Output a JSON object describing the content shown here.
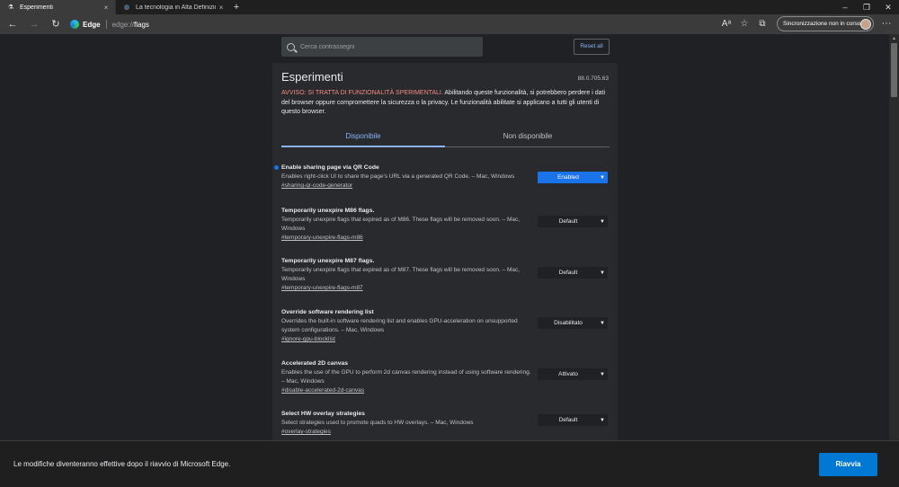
{
  "browser": {
    "tabs": [
      {
        "title": "Esperimenti",
        "close": "×",
        "icon": "flask-icon"
      },
      {
        "title": "La tecnologia in Alta Definizione",
        "close": "×",
        "icon": "globe-icon"
      }
    ],
    "new_tab": "+",
    "window_controls": {
      "minimize": "–",
      "maximize": "❐",
      "close": "✕"
    },
    "toolbar": {
      "back": "←",
      "forward": "→",
      "refresh": "↻",
      "edge_label": "Edge",
      "url_prefix": "edge://",
      "url_path": "flags",
      "sync_label": "Sincronizzazione non in corso",
      "menu": "···"
    }
  },
  "page": {
    "search_placeholder": "Cerca contrassegni",
    "reset_all": "Reset all",
    "title": "Esperimenti",
    "version": "88.0.705.63",
    "warning_label": "AVVISO: SI TRATTA DI FUNZIONALITÀ SPERIMENTALI.",
    "warning_text": " Abilitando queste funzionalità, si potrebbero perdere i dati del browser oppure compromettere la sicurezza o la privacy. Le funzionalità abilitate si applicano a tutti gli utenti di questo browser.",
    "tab_available": "Disponibile",
    "tab_unavailable": "Non disponibile",
    "flags": [
      {
        "name": "Enable sharing page via QR Code",
        "desc": "Enables right-click UI to share the page's URL via a generated QR Code. – Mac, Windows",
        "link": "#sharing-qr-code-generator",
        "value": "Enabled"
      },
      {
        "name": "Temporarily unexpire M86 flags.",
        "desc": "Temporarily unexpire flags that expired as of M86. These flags will be removed soon. – Mac, Windows",
        "link": "#temporary-unexpire-flags-m86",
        "value": "Default"
      },
      {
        "name": "Temporarily unexpire M87 flags.",
        "desc": "Temporarily unexpire flags that expired as of M87. These flags will be removed soon. – Mac, Windows",
        "link": "#temporary-unexpire-flags-m87",
        "value": "Default"
      },
      {
        "name": "Override software rendering list",
        "desc": "Overrides the built-in software rendering list and enables GPU-acceleration on unsupported system configurations. – Mac, Windows",
        "link": "#ignore-gpu-blocklist",
        "value": "Disabilitato"
      },
      {
        "name": "Accelerated 2D canvas",
        "desc": "Enables the use of the GPU to perform 2d canvas rendering instead of using software rendering. – Mac, Windows",
        "link": "#disable-accelerated-2d-canvas",
        "value": "Attivato"
      },
      {
        "name": "Select HW overlay strategies",
        "desc": "Select strategies used to promote quads to HW overlays. – Mac, Windows",
        "link": "#overlay-strategies",
        "value": "Default"
      }
    ]
  },
  "relaunch": {
    "message": "Le modifiche diventeranno effettive dopo il riavvio di Microsoft Edge.",
    "button": "Riavvia"
  },
  "colors": {
    "accent": "#1a73e8",
    "warning": "#f28b82",
    "relaunch_button": "#0078d4"
  }
}
